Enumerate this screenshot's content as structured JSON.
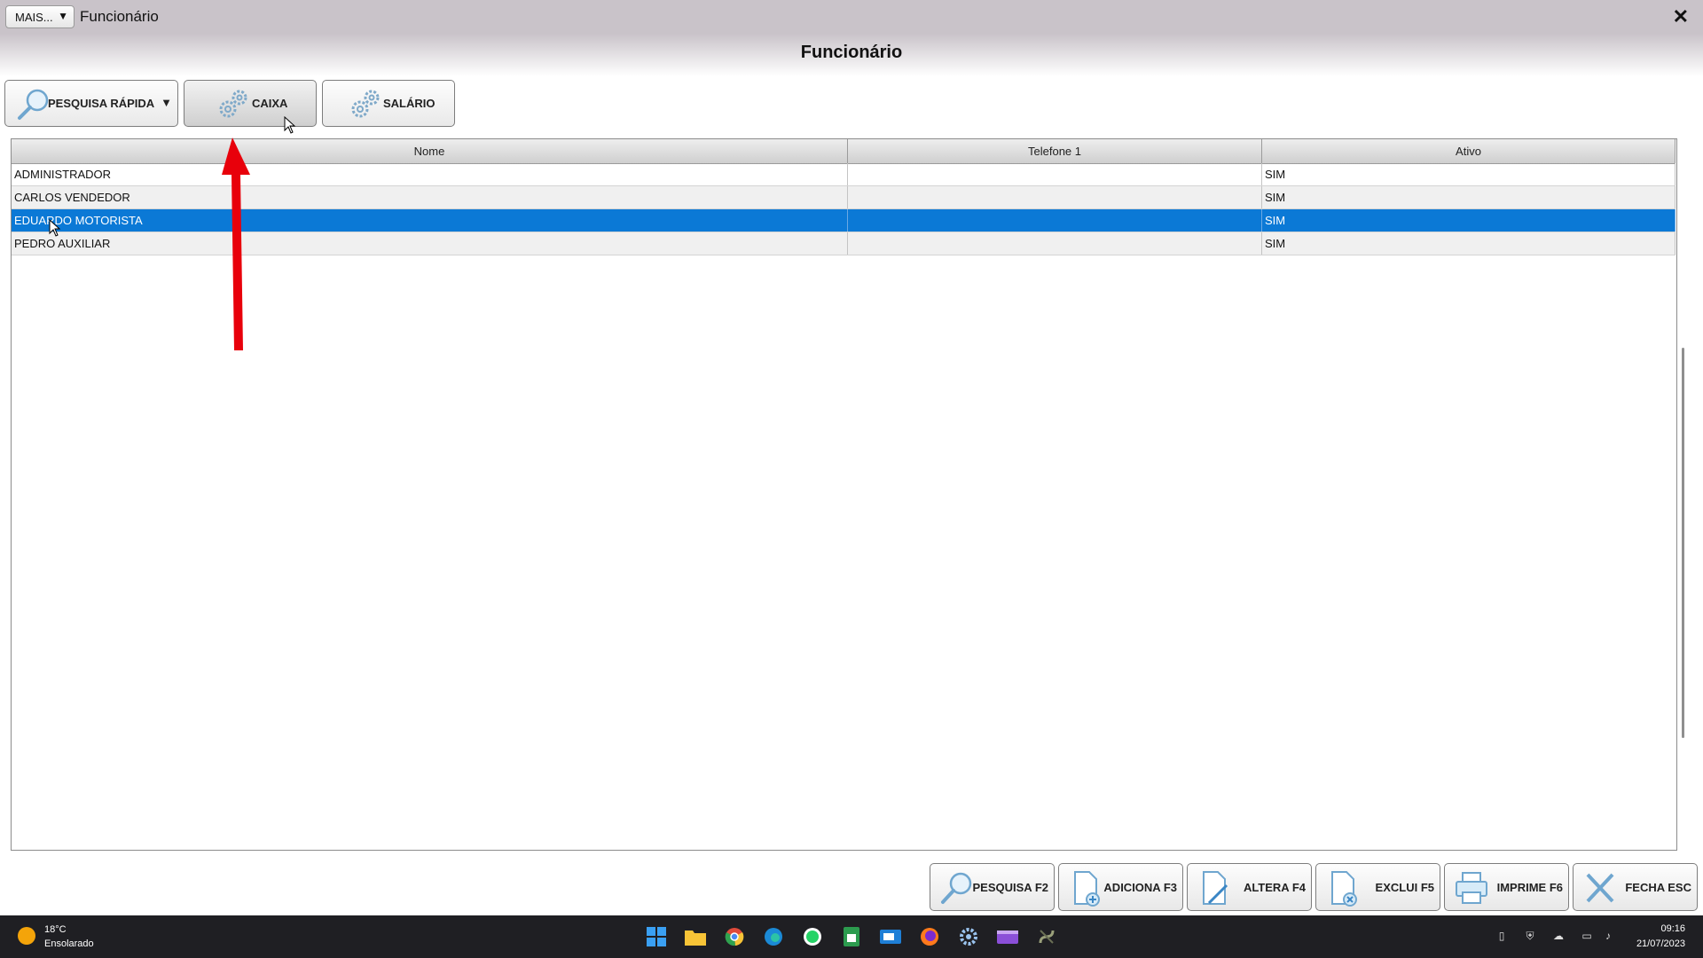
{
  "window": {
    "title": "Funcionário",
    "mais_label": "MAIS...",
    "page_title": "Funcionário"
  },
  "toolbar": {
    "quick_search_label": "PESQUISA RÁPIDA",
    "caixa_label": "CAIXA",
    "salario_label": "SALÁRIO"
  },
  "grid": {
    "columns": [
      "Nome",
      "Telefone 1",
      "Ativo"
    ],
    "rows": [
      {
        "nome": "ADMINISTRADOR",
        "telefone": "",
        "ativo": "SIM"
      },
      {
        "nome": "CARLOS VENDEDOR",
        "telefone": "",
        "ativo": "SIM"
      },
      {
        "nome": "EDUARDO MOTORISTA",
        "telefone": "",
        "ativo": "SIM"
      },
      {
        "nome": "PEDRO AUXILIAR",
        "telefone": "",
        "ativo": "SIM"
      }
    ],
    "selected_index": 2
  },
  "bottom_toolbar": {
    "pesquisa": "PESQUISA F2",
    "adiciona": "ADICIONA F3",
    "altera": "ALTERA F4",
    "exclui": "EXCLUI F5",
    "imprime": "IMPRIME F6",
    "fecha": "FECHA ESC"
  },
  "taskbar": {
    "temperature": "18°C",
    "condition": "Ensolarado",
    "time": "09:16",
    "date": "21/07/2023",
    "apps": [
      "windows-start-icon",
      "file-explorer-icon",
      "chrome-icon",
      "edge-icon",
      "whatsapp-icon",
      "sheets-icon",
      "mail-icon",
      "firefox-icon",
      "settings-icon",
      "media-icon",
      "system-app-icon"
    ]
  },
  "colors": {
    "selection": "#0b79d6",
    "annotation": "#e8000b"
  }
}
